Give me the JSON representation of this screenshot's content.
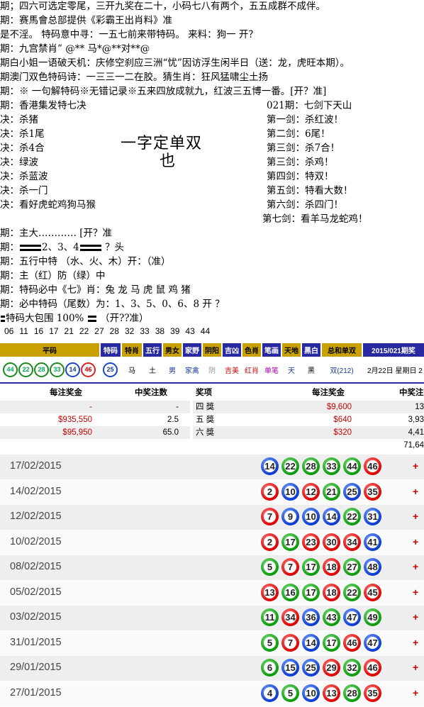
{
  "lines": [
    "期；四六可选定零尾，三开九奖在二十，小码七八有两个，五五成群不成伴。",
    "期：赛馬會总部提供《彩霸王出肖料》准",
    "是不淫。   特码意中寻：一五七前来带特码。   来料：狗一    开？",
    "期：九宫禁肖”   @** 马*@**对**@",
    "期白小姐一语破天机：庆修空刹应三洲“忧”因访浮生闲半日（送：龙，虎旺本期）。",
    "期澳门双色特码诗：一三三一二在胶。猜生肖：狂风猛啸尘土扬",
    "期：※  一句解特码※无错记录※五来四放成就九，红波三五博一番。[开？准]"
  ],
  "left_title": "期：香港集发特七决",
  "left_items": [
    "决：杀猪",
    "决：杀1尾",
    "决：杀4合",
    "决：绿波",
    "决：杀蓝波",
    "决：杀一门",
    "决：看好虎蛇鸡狗马猴"
  ],
  "center_big": [
    "一字定单双",
    "也"
  ],
  "right_title": "021期：七剑下天山",
  "right_items": [
    "第一剑：杀红波！",
    "第二剑：6尾！",
    "第三剑：杀7合！",
    "第三剑：杀鸡！",
    "第四剑：特双！",
    "第五剑：特看大数！",
    "第六剑：杀四门！"
  ],
  "right_last": "第七剑：看羊马龙蛇鸡！",
  "lines2": [
    "期：主大…………  [开？准",
    "期：",
    "期：五行中特   （水、火、木）开：（准）",
    "期：主（红）防（绿）中",
    "期：特码必中《七》肖：兔 龙 马 虎 鼠 鸡   猪",
    "期：必中特码（尾数）为：1、3、5、0、6、8        开 ？",
    "特码大包围 100%",
    "（开??准）"
  ],
  "line_bar_tail": "2、3、4",
  "line_bar_end": "？头",
  "numbers": [
    "06",
    "11",
    "16",
    "17",
    "21",
    "22",
    "27",
    "28",
    "32",
    "33",
    "38",
    "39",
    "43",
    "44"
  ],
  "band": {
    "heads": [
      "平码",
      "特码",
      "特肖",
      "五行",
      "男女",
      "家野",
      "阴阳",
      "吉凶",
      "色肖",
      "笔画",
      "天地",
      "黑白",
      "总和单双",
      "2015/021期奖"
    ],
    "balls": [
      [
        "44",
        "green"
      ],
      [
        "22",
        "green"
      ],
      [
        "28",
        "green"
      ],
      [
        "33",
        "green"
      ],
      [
        "14",
        "blue"
      ],
      [
        "46",
        "red"
      ]
    ],
    "special": "25",
    "values": [
      "马",
      "土",
      "男",
      "家禽",
      "阴",
      "吉美",
      "红肖",
      "单笔",
      "天",
      "黑",
      "双(212)",
      "2月22日 星期日 2"
    ]
  },
  "prize": {
    "headers": [
      "每注奖金",
      "中奖注数",
      "奖项",
      "每注奖金",
      "中奖注"
    ],
    "left_rows": [
      [
        "-",
        "-"
      ],
      [
        "$935,550",
        "2.5"
      ],
      [
        "$95,950",
        "65.0"
      ]
    ],
    "right_rows": [
      [
        "四 獎",
        "$9,600",
        "13"
      ],
      [
        "五 獎",
        "$640",
        "3,93"
      ],
      [
        "六 獎",
        "$320",
        "4,41"
      ],
      [
        "",
        "",
        "71,64"
      ]
    ]
  },
  "history": [
    {
      "date": "17/02/2015",
      "balls": [
        [
          "14",
          "blue"
        ],
        [
          "22",
          "green"
        ],
        [
          "28",
          "green"
        ],
        [
          "33",
          "green"
        ],
        [
          "44",
          "green"
        ],
        [
          "46",
          "red"
        ]
      ]
    },
    {
      "date": "14/02/2015",
      "balls": [
        [
          "2",
          "red"
        ],
        [
          "10",
          "blue"
        ],
        [
          "12",
          "red"
        ],
        [
          "21",
          "green"
        ],
        [
          "25",
          "blue"
        ],
        [
          "35",
          "red"
        ]
      ]
    },
    {
      "date": "12/02/2015",
      "balls": [
        [
          "7",
          "red"
        ],
        [
          "9",
          "blue"
        ],
        [
          "10",
          "blue"
        ],
        [
          "14",
          "blue"
        ],
        [
          "22",
          "green"
        ],
        [
          "31",
          "blue"
        ]
      ]
    },
    {
      "date": "10/02/2015",
      "balls": [
        [
          "2",
          "red"
        ],
        [
          "17",
          "green"
        ],
        [
          "23",
          "red"
        ],
        [
          "30",
          "red"
        ],
        [
          "34",
          "red"
        ],
        [
          "41",
          "blue"
        ]
      ]
    },
    {
      "date": "08/02/2015",
      "balls": [
        [
          "5",
          "green"
        ],
        [
          "7",
          "red"
        ],
        [
          "17",
          "green"
        ],
        [
          "18",
          "red"
        ],
        [
          "27",
          "green"
        ],
        [
          "48",
          "blue"
        ]
      ]
    },
    {
      "date": "05/02/2015",
      "balls": [
        [
          "13",
          "red"
        ],
        [
          "16",
          "green"
        ],
        [
          "17",
          "green"
        ],
        [
          "18",
          "red"
        ],
        [
          "22",
          "green"
        ],
        [
          "45",
          "red"
        ]
      ]
    },
    {
      "date": "03/02/2015",
      "balls": [
        [
          "11",
          "green"
        ],
        [
          "34",
          "red"
        ],
        [
          "36",
          "blue"
        ],
        [
          "43",
          "green"
        ],
        [
          "47",
          "blue"
        ],
        [
          "49",
          "green"
        ]
      ]
    },
    {
      "date": "31/01/2015",
      "balls": [
        [
          "5",
          "green"
        ],
        [
          "7",
          "red"
        ],
        [
          "14",
          "blue"
        ],
        [
          "17",
          "green"
        ],
        [
          "46",
          "red"
        ],
        [
          "47",
          "blue"
        ]
      ]
    },
    {
      "date": "29/01/2015",
      "balls": [
        [
          "6",
          "green"
        ],
        [
          "15",
          "blue"
        ],
        [
          "25",
          "blue"
        ],
        [
          "29",
          "red"
        ],
        [
          "32",
          "green"
        ],
        [
          "46",
          "red"
        ]
      ]
    },
    {
      "date": "27/01/2015",
      "balls": [
        [
          "4",
          "blue"
        ],
        [
          "5",
          "green"
        ],
        [
          "10",
          "blue"
        ],
        [
          "13",
          "red"
        ],
        [
          "28",
          "green"
        ],
        [
          "35",
          "red"
        ]
      ]
    }
  ],
  "colors": {
    "red": "#d00000",
    "green": "#0a9a0a",
    "blue": "#0a3ad0",
    "band_head": "#2a2aa0"
  }
}
